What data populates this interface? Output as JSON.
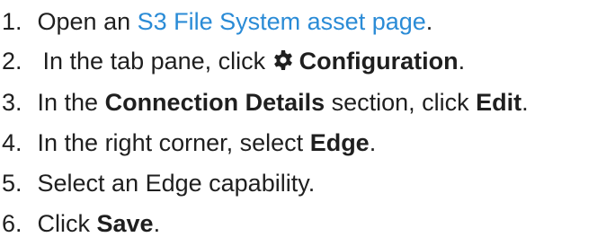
{
  "steps": [
    {
      "number": "1.",
      "before": "Open an ",
      "link": "S3 File System asset page",
      "after": "."
    },
    {
      "number": "2.",
      "before": "In the tab pane, click ",
      "icon": "gear-icon",
      "bold": "Configuration",
      "after": "."
    },
    {
      "number": "3.",
      "before": "In the ",
      "bold1": "Connection Details",
      "middle": " section, click ",
      "bold2": "Edit",
      "after": "."
    },
    {
      "number": "4.",
      "before": "In the right corner, select ",
      "bold": "Edge",
      "after": "."
    },
    {
      "number": "5.",
      "text": "Select an Edge capability."
    },
    {
      "number": "6.",
      "before": "Click ",
      "bold": "Save",
      "after": "."
    }
  ],
  "colors": {
    "text": "#1f1f1f",
    "link": "#2a8bd6"
  }
}
